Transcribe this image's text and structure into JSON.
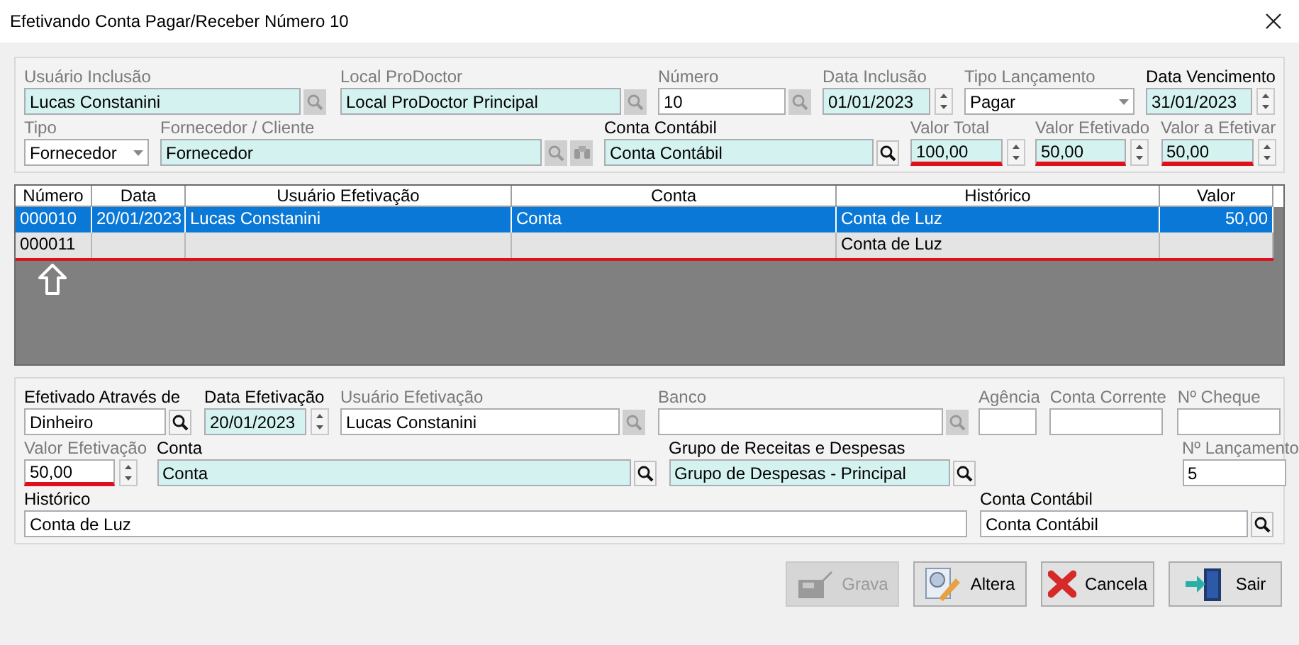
{
  "window": {
    "title": "Efetivando Conta Pagar/Receber Número 10"
  },
  "header_rows": [
    [
      {
        "label": "Usuário Inclusão",
        "value": "Lucas Constanini",
        "kind": "text",
        "required": true,
        "disabled": true,
        "buttons": [
          {
            "kind": "search",
            "disabled": true
          }
        ]
      },
      {
        "label": "Local ProDoctor",
        "value": "Local ProDoctor Principal",
        "kind": "text",
        "required": true,
        "disabled": true,
        "buttons": [
          {
            "kind": "search",
            "disabled": true
          }
        ]
      },
      {
        "label": "Número",
        "value": "10",
        "kind": "text",
        "required": false,
        "disabled": true,
        "buttons": [
          {
            "kind": "search",
            "disabled": true
          }
        ]
      },
      {
        "label": "Data Inclusão",
        "value": "01/01/2023",
        "kind": "spin",
        "required": true,
        "disabled": true
      },
      {
        "label": "Tipo Lançamento",
        "value": "Pagar",
        "kind": "combo",
        "required": false,
        "disabled": true
      },
      {
        "label": "Data Vencimento",
        "value": "31/01/2023",
        "kind": "spin",
        "required": true,
        "disabled": false
      }
    ],
    [
      {
        "label": "Tipo",
        "value": "Fornecedor",
        "kind": "combo",
        "required": false,
        "disabled": true
      },
      {
        "label": "Fornecedor / Cliente",
        "value": "Fornecedor",
        "kind": "text",
        "required": true,
        "disabled": true,
        "buttons": [
          {
            "kind": "search",
            "disabled": true
          },
          {
            "kind": "binoculars",
            "disabled": true
          }
        ]
      },
      {
        "label": "Conta Contábil",
        "value": "Conta Contábil",
        "kind": "text",
        "required": true,
        "disabled": false,
        "buttons": [
          {
            "kind": "search",
            "disabled": false
          }
        ]
      },
      {
        "label": "Valor Total",
        "value": "100,00",
        "kind": "spin",
        "required": true,
        "disabled": true,
        "underlined": true
      },
      {
        "label": "Valor Efetivado",
        "value": "50,00",
        "kind": "spin",
        "required": true,
        "disabled": true,
        "underlined": true
      },
      {
        "label": "Valor a Efetivar",
        "value": "50,00",
        "kind": "spin",
        "required": true,
        "disabled": true,
        "underlined": true
      }
    ]
  ],
  "table": {
    "columns": [
      "Número",
      "Data",
      "Usuário Efetivação",
      "Conta",
      "Histórico",
      "Valor"
    ],
    "rows": [
      {
        "cells": [
          "000010",
          "20/01/2023",
          "Lucas Constanini",
          "Conta",
          "Conta de Luz",
          "50,00"
        ],
        "selected": true,
        "underlined": false
      },
      {
        "cells": [
          "000011",
          "",
          "",
          "",
          "Conta de Luz",
          ""
        ],
        "selected": false,
        "underlined": true
      }
    ]
  },
  "detail_rows": [
    [
      {
        "label": "Efetivado Através de",
        "value": "Dinheiro",
        "kind": "text",
        "required": false,
        "disabled": false,
        "buttons": [
          {
            "kind": "search",
            "disabled": false
          }
        ]
      },
      {
        "label": "Data Efetivação",
        "value": "20/01/2023",
        "kind": "spin",
        "required": true,
        "disabled": false
      },
      {
        "label": "Usuário Efetivação",
        "value": "Lucas Constanini",
        "kind": "text",
        "required": false,
        "disabled": true,
        "buttons": [
          {
            "kind": "search",
            "disabled": true
          }
        ]
      },
      {
        "label": "Banco",
        "kind": "text",
        "required": false,
        "disabled": true,
        "buttons": [
          {
            "kind": "search",
            "disabled": true
          }
        ]
      },
      {
        "label": "Agência",
        "kind": "text",
        "required": false,
        "disabled": true
      },
      {
        "label": "Conta Corrente",
        "kind": "text",
        "required": false,
        "disabled": true
      },
      {
        "label": "Nº Cheque",
        "kind": "text",
        "required": false,
        "disabled": true
      }
    ],
    [
      {
        "label": "Valor Efetivação",
        "value": "50,00",
        "kind": "spin",
        "required": false,
        "disabled": true,
        "underlined": true
      },
      {
        "label": "Conta",
        "value": "Conta",
        "kind": "text",
        "required": true,
        "disabled": false,
        "buttons": [
          {
            "kind": "search",
            "disabled": false
          }
        ]
      },
      {
        "label": "Grupo de Receitas e Despesas",
        "value": "Grupo de Despesas - Principal",
        "kind": "text",
        "required": true,
        "disabled": false,
        "buttons": [
          {
            "kind": "search",
            "disabled": false
          }
        ]
      },
      {
        "label": "Nº Lançamento",
        "value": "5",
        "kind": "text",
        "required": false,
        "disabled": true
      }
    ],
    [
      {
        "label": "Histórico",
        "value": "Conta de Luz",
        "kind": "text",
        "required": false,
        "disabled": false
      },
      {
        "label": "Conta Contábil",
        "value": "Conta Contábil",
        "kind": "text",
        "required": false,
        "disabled": false,
        "buttons": [
          {
            "kind": "search",
            "disabled": false
          }
        ]
      }
    ]
  ],
  "buttons": [
    {
      "label": "Grava",
      "kind": "save",
      "disabled": true
    },
    {
      "label": "Altera",
      "kind": "edit",
      "disabled": false
    },
    {
      "label": "Cancela",
      "kind": "cancel",
      "disabled": false
    },
    {
      "label": "Sair",
      "kind": "exit",
      "disabled": false
    }
  ]
}
